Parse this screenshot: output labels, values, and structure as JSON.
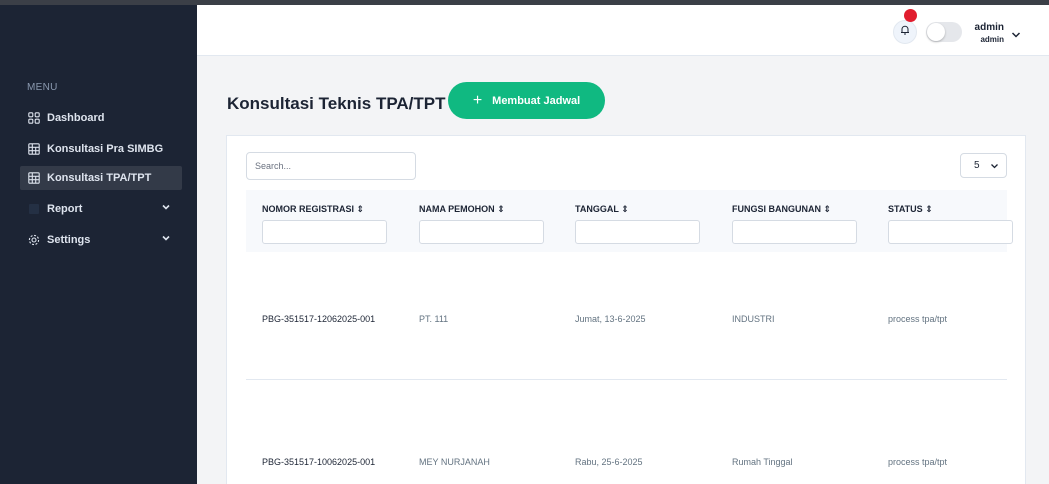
{
  "sidebar": {
    "menu_label": "MENU",
    "items": [
      {
        "label": "Dashboard",
        "icon": "dashboard-icon"
      },
      {
        "label": "Konsultasi Pra SIMBG",
        "icon": "table-icon"
      },
      {
        "label": "Konsultasi TPA/TPT",
        "icon": "table-icon",
        "active": true
      },
      {
        "label": "Report",
        "icon": "report-icon"
      },
      {
        "label": "Settings",
        "icon": "gear-icon"
      }
    ]
  },
  "header": {
    "user_name": "admin",
    "user_role": "admin"
  },
  "page": {
    "title": "Konsultasi Teknis TPA/TPT",
    "add_button_label": "Membuat Jadwal"
  },
  "table": {
    "search_placeholder": "Search...",
    "page_size": "5",
    "columns": [
      {
        "label": "NOMOR REGISTRASI",
        "sort_icon": "sort-icon"
      },
      {
        "label": "NAMA PEMOHON",
        "sort_icon": "sort-icon"
      },
      {
        "label": "TANGGAL",
        "sort_icon": "sort-icon"
      },
      {
        "label": "FUNGSI BANGUNAN",
        "sort_icon": "sort-icon"
      },
      {
        "label": "STATUS",
        "sort_icon": "sort-icon"
      }
    ],
    "rows": [
      [
        "PBG-351517-12062025-001",
        "PT. 111",
        "Jumat, 13-6-2025",
        "INDUSTRI",
        "process tpa/tpt"
      ],
      [
        "PBG-351517-10062025-001",
        "MEY NURJANAH",
        "Rabu, 25-6-2025",
        "Rumah Tinggal",
        "process tpa/tpt"
      ]
    ]
  },
  "colors": {
    "sidebar_bg": "#1c2434",
    "accent_green": "#10b981",
    "notification_red": "#e11d2e"
  }
}
